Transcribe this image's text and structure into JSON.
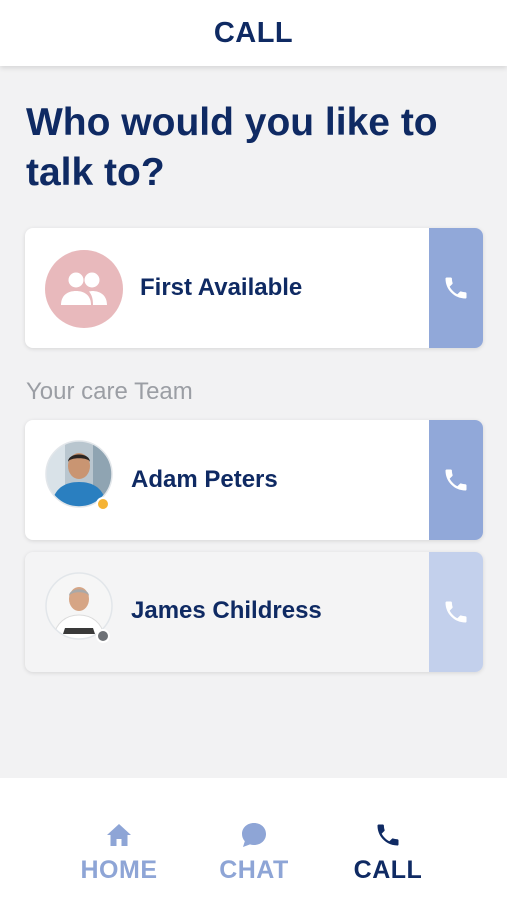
{
  "header": {
    "title": "CALL"
  },
  "heading": "Who would you like to talk to?",
  "first_available": {
    "label": "First Available",
    "avatar_icon": "group-icon",
    "call_icon": "phone-icon"
  },
  "care_team": {
    "label": "Your care Team",
    "members": [
      {
        "name": "Adam Peters",
        "status": "away",
        "status_color": "#f5b335"
      },
      {
        "name": "James Childress",
        "status": "offline",
        "status_color": "#6f7277"
      }
    ]
  },
  "tabs": [
    {
      "label": "HOME",
      "icon": "home-icon",
      "active": false
    },
    {
      "label": "CHAT",
      "icon": "chat-bubble-icon",
      "active": false
    },
    {
      "label": "CALL",
      "icon": "phone-icon",
      "active": true
    }
  ],
  "colors": {
    "primary": "#0f2a63",
    "call_button": "#91a8d9",
    "call_button_disabled": "#c3d0ec",
    "group_avatar": "#e8b9bc",
    "inactive_tab": "#8ea5d6"
  }
}
